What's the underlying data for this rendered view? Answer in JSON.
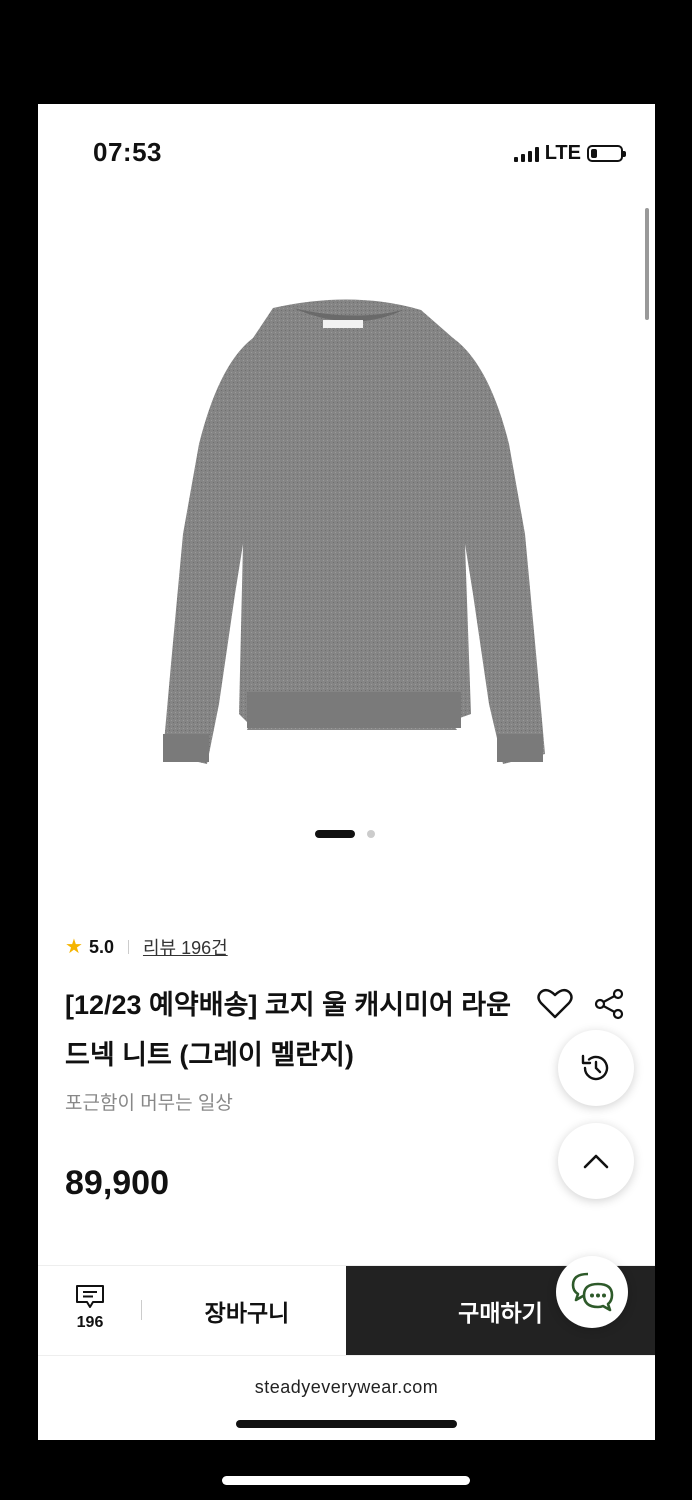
{
  "status_bar": {
    "time": "07:53",
    "network": "LTE",
    "battery_level": 0.2
  },
  "product": {
    "image_icon": "sweater-image",
    "carousel": {
      "pages": 2,
      "active": 1
    },
    "rating": "5.0",
    "review_link": "리뷰 196건",
    "title": "[12/23 예약배송] 코지 울 캐시미어 라운드넥 니트 (그레이 멜란지)",
    "subtitle": "포근함이 머무는 일상",
    "price": "89,900"
  },
  "bottom_bar": {
    "review_count": "196",
    "cart_label": "장바구니",
    "buy_label": "구매하기"
  },
  "browser": {
    "url": "steadyeverywear.com"
  },
  "colors": {
    "buy_button_bg": "#222222",
    "star": "#f5b400",
    "chat_icon": "#2e5a2a"
  }
}
